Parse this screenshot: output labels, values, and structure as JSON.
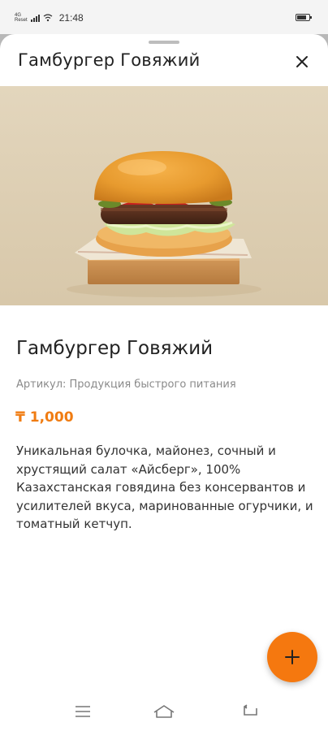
{
  "status_bar": {
    "network_type": "4G",
    "network_label": "Reset",
    "time": "21:48",
    "icons": [
      "signal-icon",
      "wifi-icon",
      "battery-icon"
    ]
  },
  "sheet": {
    "header_title": "Гамбургер Говяжий",
    "close_icon": "close-icon"
  },
  "product": {
    "image_alt": "burger-image",
    "title": "Гамбургер Говяжий",
    "article": "Артикул: Продукция быстрого питания",
    "price": "₸ 1,000",
    "description": "Уникальная булочка, майонез, сочный и хрустящий салат «Айсберг», 100% Казахстанская говядина без консервантов и усилителей вкуса, маринованные огурчики, и томатный кетчуп."
  },
  "fab": {
    "icon": "plus-icon"
  },
  "nav": {
    "icons": [
      "menu-icon",
      "home-icon",
      "back-icon"
    ]
  },
  "colors": {
    "accent": "#f5780f",
    "price": "#f07c12",
    "text": "#222222",
    "muted": "#8a8a8a"
  }
}
